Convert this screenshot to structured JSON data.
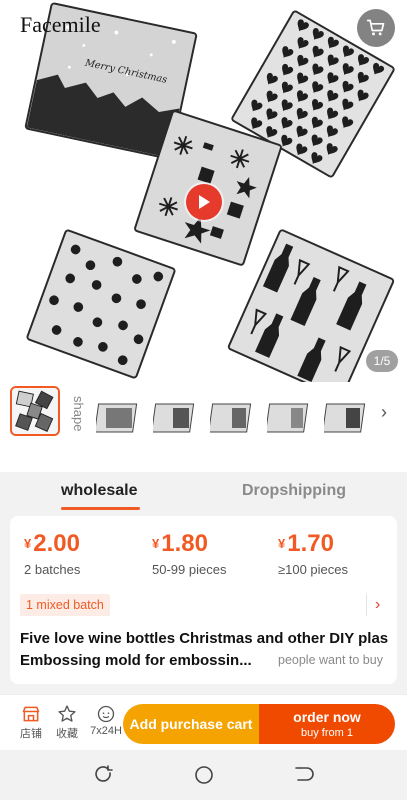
{
  "hero": {
    "brand": "Facemile",
    "counter": "1/5",
    "icons": {
      "cart": "cart-icon",
      "play": "play-icon"
    }
  },
  "thumbs": {
    "shape_label": "shape",
    "count_after_main": 6
  },
  "tabs": [
    {
      "label": "wholesale",
      "active": true
    },
    {
      "label": "Dropshipping",
      "active": false
    }
  ],
  "pricing": {
    "currency": "¥",
    "tiers": [
      {
        "price": "2.00",
        "qty": "2 batches"
      },
      {
        "price": "1.80",
        "qty": "50-99 pieces"
      },
      {
        "price": "1.70",
        "qty": "≥100 pieces"
      }
    ],
    "mixed_batch": "1 mixed batch"
  },
  "product": {
    "title_line1": "Five love wine bottles Christmas and other DIY plas",
    "title_line2": "Embossing mold for embossin...",
    "want_text": "people want to buy"
  },
  "bottom_bar": {
    "store": "店铺",
    "favorite": "收藏",
    "service": "7x24H",
    "add_cart": "Add purchase cart",
    "order_now": "order now",
    "buy_from": "buy from 1"
  },
  "colors": {
    "accent": "#f15a24",
    "cart_button": "#f5a300",
    "order_button": "#f04a00"
  }
}
